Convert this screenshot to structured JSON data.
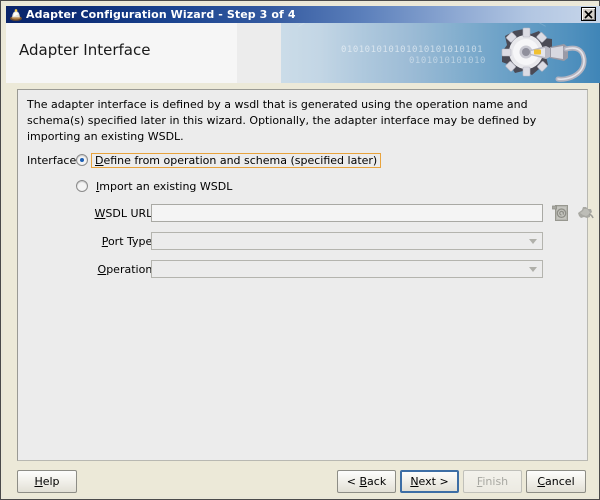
{
  "window": {
    "title": "Adapter Configuration Wizard - Step 3 of 4",
    "title_icon": "wizard-hat-icon",
    "close_icon": "close-icon",
    "titlebar_gradient_start": "#0a246a",
    "titlebar_gradient_end": "#c7d6ea"
  },
  "banner": {
    "heading": "Adapter Interface",
    "art_icon": "gear-with-cable-icon",
    "binary_text": "010101010101010101010101",
    "binary_text_2": "0101010101010",
    "gradient_start": "#cbdce8",
    "gradient_end": "#3f85b7"
  },
  "main": {
    "description": "The adapter interface is defined by a wsdl that is generated using the operation name and schema(s) specified later in this wizard.  Optionally, the adapter interface may be defined by importing an existing WSDL.",
    "interface_label": "Interface:",
    "options": [
      {
        "label_before": "D",
        "mnemonic": "D",
        "label": "efine from operation and schema (specified later)",
        "full_label": "Define from operation and schema (specified later)",
        "selected": true,
        "focused": true,
        "focus_color": "#e8a33d"
      },
      {
        "mnemonic": "I",
        "label": "mport an existing WSDL",
        "full_label": "Import an existing WSDL",
        "selected": false,
        "focused": false
      }
    ],
    "fields": [
      {
        "mnemonic": "W",
        "label": "SDL URL:",
        "full_label": "WSDL URL:",
        "type": "text",
        "value": "",
        "placeholder": "",
        "enabled": true
      },
      {
        "mnemonic": "P",
        "label": "ort Type:",
        "full_label": "Port Type:",
        "type": "combo",
        "value": "",
        "enabled": false
      },
      {
        "mnemonic": "O",
        "label": "peration:",
        "full_label": "Operation:",
        "type": "combo",
        "value": "",
        "enabled": false
      }
    ],
    "icon_buttons": [
      {
        "icon": "browse-wsdl-document-icon",
        "enabled": false
      },
      {
        "icon": "search-wsdl-icon",
        "enabled": false
      }
    ]
  },
  "footer": {
    "buttons": [
      {
        "label": "Help",
        "mnemonic": "H",
        "enabled": true,
        "focused": false
      },
      {
        "label": "< Back",
        "mnemonic": "B",
        "enabled": true,
        "focused": false
      },
      {
        "label": "Next >",
        "mnemonic": "N",
        "enabled": true,
        "focused": true
      },
      {
        "label": "Finish",
        "mnemonic": "F",
        "enabled": false,
        "focused": false
      },
      {
        "label": "Cancel",
        "mnemonic": "C",
        "enabled": true,
        "focused": false
      }
    ],
    "focus_border_color": "#3d6ea5"
  }
}
